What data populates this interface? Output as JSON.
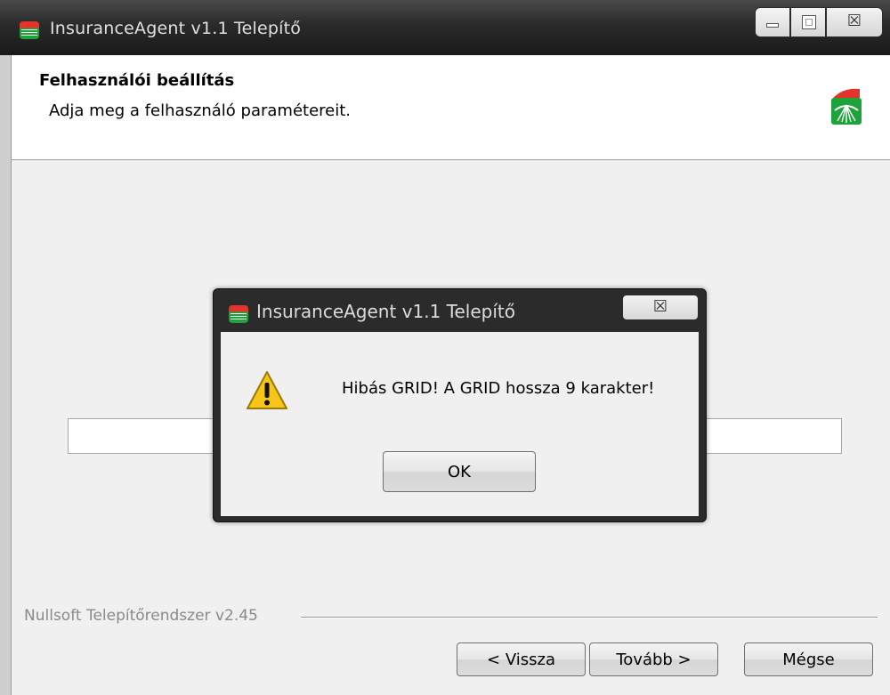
{
  "window": {
    "title": "InsuranceAgent v1.1 Telepítő",
    "app_icon": "installer-logo-icon",
    "controls": {
      "minimize": "minimize-icon",
      "maximize": "maximize-icon",
      "close_glyph": "☒"
    }
  },
  "header": {
    "title": "Felhasználói beállítás",
    "subtitle": "Adja meg a felhasználó paramétereit.",
    "logo": "brand-logo-icon"
  },
  "form": {
    "field_value": ""
  },
  "footer": {
    "branding": "Nullsoft Telepítőrendszer v2.45",
    "back_label": "< Vissza",
    "next_label": "Tovább >",
    "cancel_label": "Mégse"
  },
  "dialog": {
    "title": "InsuranceAgent v1.1 Telepítő",
    "icon": "warning-icon",
    "message": "Hibás GRID! A GRID hossza 9 karakter!",
    "ok_label": "OK",
    "close_glyph": "☒"
  },
  "colors": {
    "titlebar": "#1a1a1a",
    "logo_red": "#e2342b",
    "logo_green": "#1ea33a",
    "warning_yellow": "#f5c518"
  }
}
